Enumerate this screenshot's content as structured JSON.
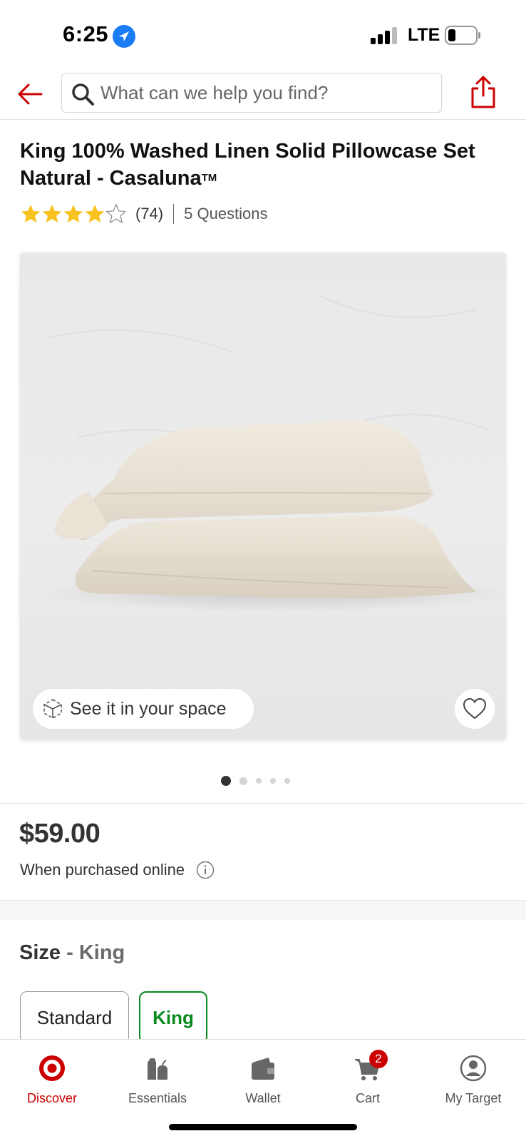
{
  "status_bar": {
    "time": "6:25",
    "network": "LTE",
    "icons": [
      "location-arrow-icon",
      "signal-bars-icon",
      "battery-icon"
    ]
  },
  "header": {
    "back_icon": "arrow-left-icon",
    "search_placeholder": "What can we help you find?",
    "share_icon": "share-icon"
  },
  "product": {
    "title": "King 100% Washed Linen Solid Pillowcase Set Natural - Casaluna",
    "trademark": "TM",
    "rating": 4.5,
    "rating_max": 5,
    "review_count": "(74)",
    "questions": "5 Questions",
    "see_in_space": "See it in your space",
    "image_count": 5,
    "active_image": 1,
    "price": "$59.00",
    "price_note": "When purchased online"
  },
  "size": {
    "label": "Size",
    "separator": " - ",
    "selected": "King",
    "options": [
      "Standard",
      "King"
    ]
  },
  "tabbar": {
    "items": [
      {
        "label": "Discover",
        "icon": "target-logo-icon",
        "active": true
      },
      {
        "label": "Essentials",
        "icon": "essentials-icon"
      },
      {
        "label": "Wallet",
        "icon": "wallet-icon"
      },
      {
        "label": "Cart",
        "icon": "cart-icon",
        "badge": "2"
      },
      {
        "label": "My Target",
        "icon": "account-icon"
      }
    ]
  },
  "colors": {
    "brand_red": "#cc0000",
    "selected_green": "#0a8a1e",
    "location_blue": "#1a7cf5",
    "star_gold": "#f7c21e"
  }
}
